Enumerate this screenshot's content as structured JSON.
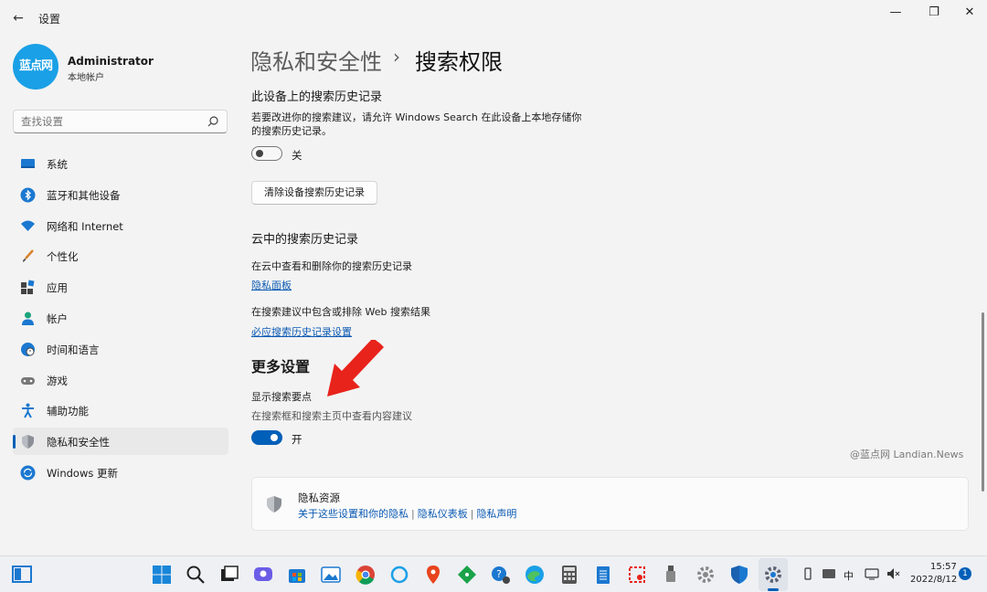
{
  "window": {
    "title": "设置",
    "minimize_glyph": "—",
    "maximize_glyph": "❐",
    "close_glyph": "✕",
    "back_glyph": "←"
  },
  "profile": {
    "avatar_text": "蓝点网",
    "name": "Administrator",
    "account_type": "本地帐户"
  },
  "search": {
    "placeholder": "查找设置"
  },
  "sidebar": {
    "items": [
      {
        "label": "系统",
        "icon": "monitor-icon"
      },
      {
        "label": "蓝牙和其他设备",
        "icon": "bluetooth-icon"
      },
      {
        "label": "网络和 Internet",
        "icon": "wifi-icon"
      },
      {
        "label": "个性化",
        "icon": "brush-icon"
      },
      {
        "label": "应用",
        "icon": "apps-icon"
      },
      {
        "label": "帐户",
        "icon": "person-icon"
      },
      {
        "label": "时间和语言",
        "icon": "clock-globe-icon"
      },
      {
        "label": "游戏",
        "icon": "gamepad-icon"
      },
      {
        "label": "辅助功能",
        "icon": "accessibility-icon"
      },
      {
        "label": "隐私和安全性",
        "icon": "shield-icon",
        "active": true
      },
      {
        "label": "Windows 更新",
        "icon": "update-icon"
      }
    ]
  },
  "breadcrumb": {
    "parent": "隐私和安全性",
    "separator": "›",
    "current": "搜索权限"
  },
  "device_history": {
    "heading": "此设备上的搜索历史记录",
    "description_line1": "若要改进你的搜索建议，请允许 Windows Search 在此设备上本地存储你",
    "description_line2": "的搜索历史记录。",
    "toggle_state": "off",
    "toggle_label": "关",
    "clear_button": "清除设备搜索历史记录"
  },
  "cloud_history": {
    "heading": "云中的搜索历史记录",
    "view_text": "在云中查看和删除你的搜索历史记录",
    "privacy_dashboard_link": "隐私面板",
    "web_text": "在搜索建议中包含或排除 Web 搜索结果",
    "bing_settings_link": "必应搜索历史记录设置"
  },
  "more_settings": {
    "heading": "更多设置",
    "highlights_title": "显示搜索要点",
    "highlights_desc": "在搜索框和搜索主页中查看内容建议",
    "toggle_state": "on",
    "toggle_label": "开"
  },
  "watermark": "@蓝点网 Landian.News",
  "privacy_resources": {
    "title": "隐私资源",
    "links": [
      "关于这些设置和你的隐私",
      "隐私仪表板",
      "隐私声明"
    ],
    "separator": "|"
  },
  "taskbar": {
    "apps": [
      "start-icon",
      "search-icon",
      "task-view-icon",
      "chat-icon",
      "store-icon",
      "photos-icon",
      "chrome-icon",
      "cortana-icon",
      "maps-icon",
      "git-icon",
      "help-icon",
      "edge-icon",
      "calculator-icon",
      "notepad-icon",
      "snip-icon",
      "usb-icon",
      "settings-gear-icon",
      "defender-icon",
      "settings-active-icon"
    ],
    "tray_ime": "中",
    "time": "15:57",
    "date": "2022/8/12",
    "notification_count": "1"
  },
  "colors": {
    "accent": "#005fb8",
    "avatar": "#1aa0e6",
    "link": "#0b5ab3",
    "arrow": "#e8231b"
  }
}
